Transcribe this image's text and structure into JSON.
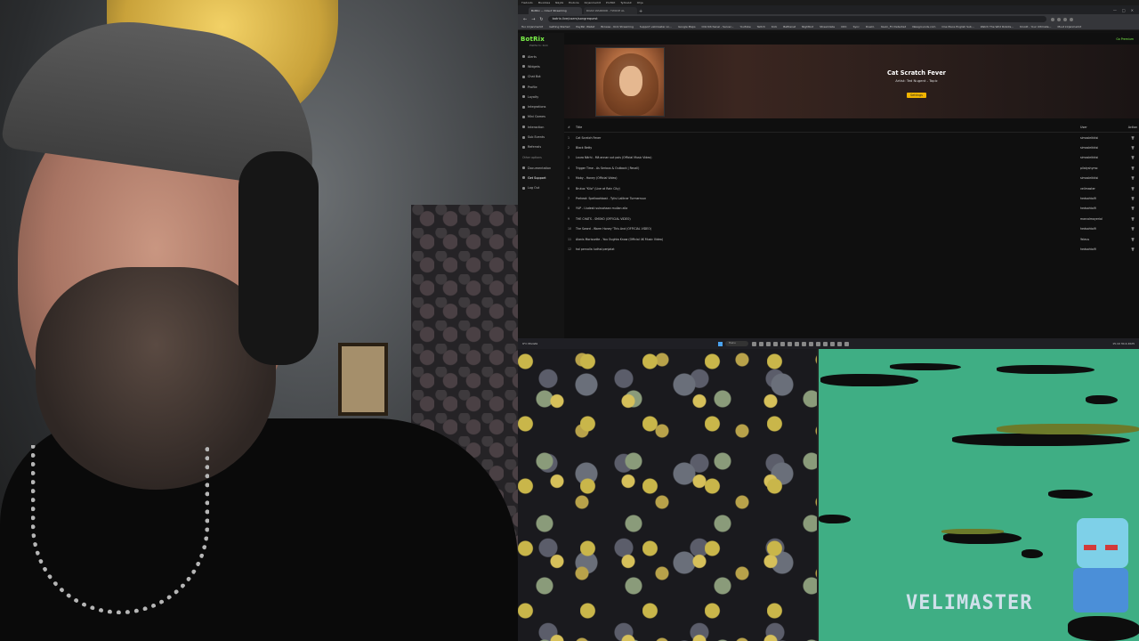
{
  "browser": {
    "menu": [
      "Tiedosto",
      "Muokkaa",
      "Näytä",
      "Historia",
      "Kirjanmerkit",
      "Profiilit",
      "Työkalut",
      "Ohje"
    ],
    "tabs": [
      {
        "label": "BotRix — Cloud Streaming"
      },
      {
        "label": "ROAD WARRIOR - TWOCE AL"
      }
    ],
    "url": "botrix.live/users/songrequest",
    "bookmarks": [
      "Tuo kirjanmerkit",
      "Getting Started",
      "PayPal: Wallet",
      "Browse - Kick Streaming",
      "Support velimaster on...",
      "Google Maps",
      "Oliz Kitchenel - Server...",
      "YouTube",
      "Twitch",
      "Kick",
      "Battlenet",
      "Nightbot",
      "Streamlabs",
      "CDC",
      "Sync",
      "Downl.",
      "Kevin_FC Detected",
      "Newgrounds.com",
      "One Piece English Sub...",
      "Watch The Wild Robots...",
      "Kinolit - Your Ultimate...",
      "Muut kirjanmerkit"
    ]
  },
  "app": {
    "brand": "BotRix",
    "brand_sub": "Platform: Kick",
    "go_premium": "Go Premium",
    "sidebar_items": [
      "Alerts",
      "Widgets",
      "Chat Bot",
      "Profile",
      "Loyalty",
      "Integrations",
      "Mini Games",
      "Interaction",
      "Sub Events",
      "Referrals"
    ],
    "other_options_label": "Other options",
    "other_items": [
      "Documentation",
      "Get Support",
      "Log Out"
    ],
    "now_playing": {
      "title": "Cat Scratch Fever",
      "artist": "Artist: Ted Nugent - Topic",
      "button": "Settings"
    },
    "queue_headers": {
      "num": "#",
      "title": "Title",
      "user": "User",
      "action": "Action"
    },
    "queue": [
      {
        "num": "1",
        "title": "Cat Scratch Fever",
        "user": "simosleikkisi"
      },
      {
        "num": "2",
        "title": "Black Betty",
        "user": "simosleikkisi"
      },
      {
        "num": "3",
        "title": "Laura Närhi - Mä annan sut pois (Official Music Video)",
        "user": "simosleikkisi"
      },
      {
        "num": "4",
        "title": "Trigger Time - As Serious & Outback | Recall)",
        "user": "pilatyshymo"
      },
      {
        "num": "5",
        "title": "Moby - Honey (Official Video)",
        "user": "simosleikkisi"
      },
      {
        "num": "6",
        "title": "Brutus \"Kilo\" (Live at Rain City)",
        "user": "velimaster"
      },
      {
        "num": "7",
        "title": "Preheat: Spelkaahbast - Tylisi Lalitner Turmerruun",
        "user": "hedsahtolfi"
      },
      {
        "num": "8",
        "title": "YUP - Uudesti suksahaan mullan alla",
        "user": "hedsahtolfi"
      },
      {
        "num": "9",
        "title": "THE CHATS - SMOKO (OFFICIAL VIDEO)",
        "user": "marcalmayerial"
      },
      {
        "num": "10",
        "title": "The Sword - Warm Honey 'This And (OFFICIAL VIDEO)",
        "user": "hedsahtolfi"
      },
      {
        "num": "11",
        "title": "Alanis Morissette - You Oughta Know (Official 4K Music Video)",
        "user": "Yeleus"
      },
      {
        "num": "12",
        "title": "hal pervolla ludhal penjalat",
        "user": "hedsahtolfi"
      }
    ]
  },
  "taskbar": {
    "weather": "9°C Pilvistä",
    "search_placeholder": "Haku",
    "clock": "15.10\n30.4.2025"
  },
  "stream": {
    "logo": "VELIMASTER"
  }
}
